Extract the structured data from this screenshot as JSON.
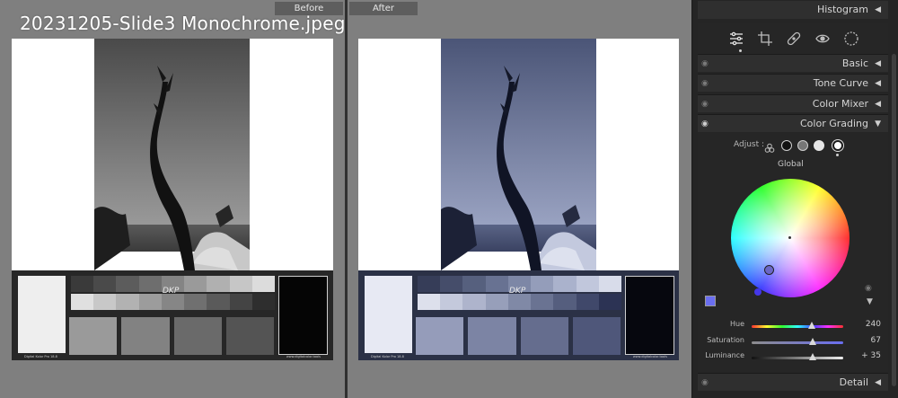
{
  "file_title": "20231205-Slide3 Monochrome.jpeg",
  "panes": {
    "before_label": "Before",
    "after_label": "After"
  },
  "chart_text": {
    "dkp": "DKP",
    "brand_left": "Digital Kolor Pro 18.8",
    "brand_right": "www.digitalcolor.tools"
  },
  "panel": {
    "histogram": "Histogram",
    "sections": {
      "basic": "Basic",
      "tone_curve": "Tone Curve",
      "color_mixer": "Color Mixer",
      "color_grading": "Color Grading",
      "detail": "Detail"
    },
    "tools": [
      "edit-sliders-icon",
      "crop-icon",
      "healing-icon",
      "redeye-icon",
      "mask-icon"
    ]
  },
  "color_grading": {
    "adjust_label": "Adjust :",
    "mode": "Global",
    "swatch_color": "#6a6ef0",
    "sliders": [
      {
        "label": "Hue",
        "value": "240",
        "fraction": 0.66
      },
      {
        "label": "Saturation",
        "value": "67",
        "fraction": 0.67
      },
      {
        "label": "Luminance",
        "value": "+ 35",
        "fraction": 0.67
      }
    ]
  },
  "colors": {
    "accent": "#6a6ef0",
    "panel_bg": "#252525"
  }
}
